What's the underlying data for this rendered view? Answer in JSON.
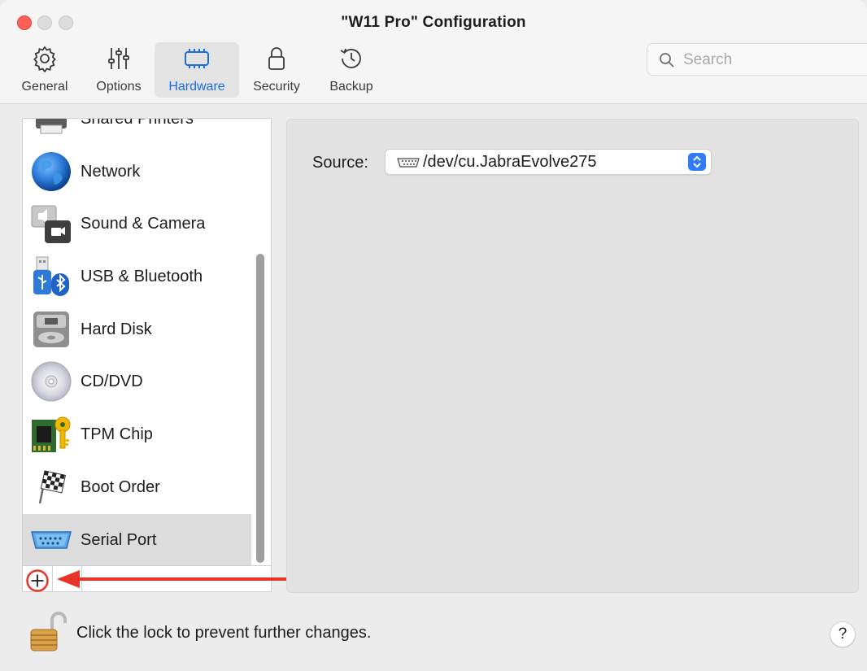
{
  "window": {
    "title": "\"W11 Pro\" Configuration"
  },
  "toolbar": {
    "items": [
      {
        "label": "General",
        "icon": "gear-icon"
      },
      {
        "label": "Options",
        "icon": "sliders-icon"
      },
      {
        "label": "Hardware",
        "icon": "chip-icon",
        "selected": true
      },
      {
        "label": "Security",
        "icon": "lock-icon"
      },
      {
        "label": "Backup",
        "icon": "clock-history-icon"
      }
    ],
    "search_placeholder": "Search"
  },
  "sidebar": {
    "items": [
      {
        "label": "Shared Printers",
        "icon": "printer-icon"
      },
      {
        "label": "Network",
        "icon": "globe-icon"
      },
      {
        "label": "Sound & Camera",
        "icon": "speaker-camera-icon"
      },
      {
        "label": "USB & Bluetooth",
        "icon": "usb-bluetooth-icon"
      },
      {
        "label": "Hard Disk",
        "icon": "hard-disk-icon"
      },
      {
        "label": "CD/DVD",
        "icon": "cd-icon"
      },
      {
        "label": "TPM Chip",
        "icon": "tpm-chip-icon"
      },
      {
        "label": "Boot Order",
        "icon": "checkered-flag-icon"
      },
      {
        "label": "Serial Port",
        "icon": "serial-port-icon",
        "selected": true
      }
    ],
    "add_button_symbol": "+"
  },
  "detail": {
    "source_label": "Source:",
    "source_value": "/dev/cu.JabraEvolve275"
  },
  "footer": {
    "lock_text": "Click the lock to prevent further changes.",
    "help_symbol": "?"
  },
  "colors": {
    "accent": "#1a6fe0",
    "annotation": "#e8332a",
    "close": "#fe5f57"
  }
}
